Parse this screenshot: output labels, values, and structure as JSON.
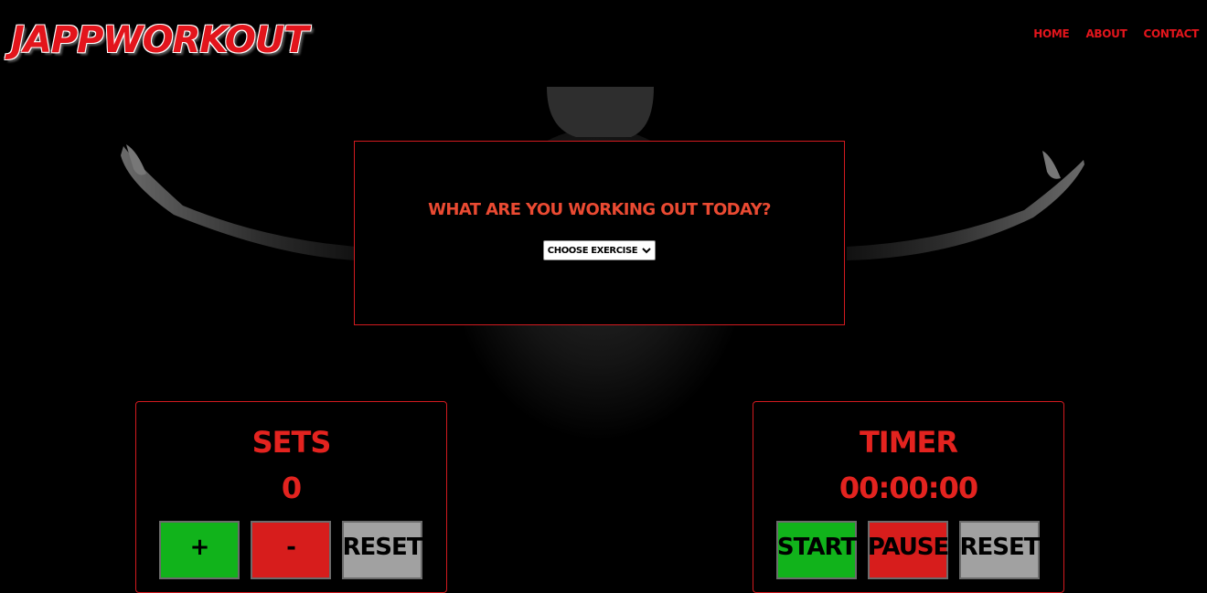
{
  "brand": {
    "logo": "JAPPWORKOUT",
    "accent_color": "#e3151c"
  },
  "nav": {
    "items": [
      {
        "label": "HOME"
      },
      {
        "label": "ABOUT"
      },
      {
        "label": "CONTACT"
      }
    ]
  },
  "exercise": {
    "question": "WHAT ARE YOU WORKING OUT TODAY?",
    "select_value": "CHOOSE EXERCISE",
    "select_icon": "chevron-down-icon"
  },
  "sets": {
    "title": "SETS",
    "value": "0",
    "buttons": {
      "increment": "+",
      "decrement": "-",
      "reset": "RESET"
    }
  },
  "timer": {
    "title": "TIMER",
    "value": "00:00:00",
    "buttons": {
      "start": "START",
      "pause": "PAUSE",
      "reset": "RESET"
    }
  },
  "colors": {
    "green": "#11b31b",
    "red": "#d71d1c",
    "grey": "#a1a1a1",
    "panel_border": "#d21a1f"
  }
}
